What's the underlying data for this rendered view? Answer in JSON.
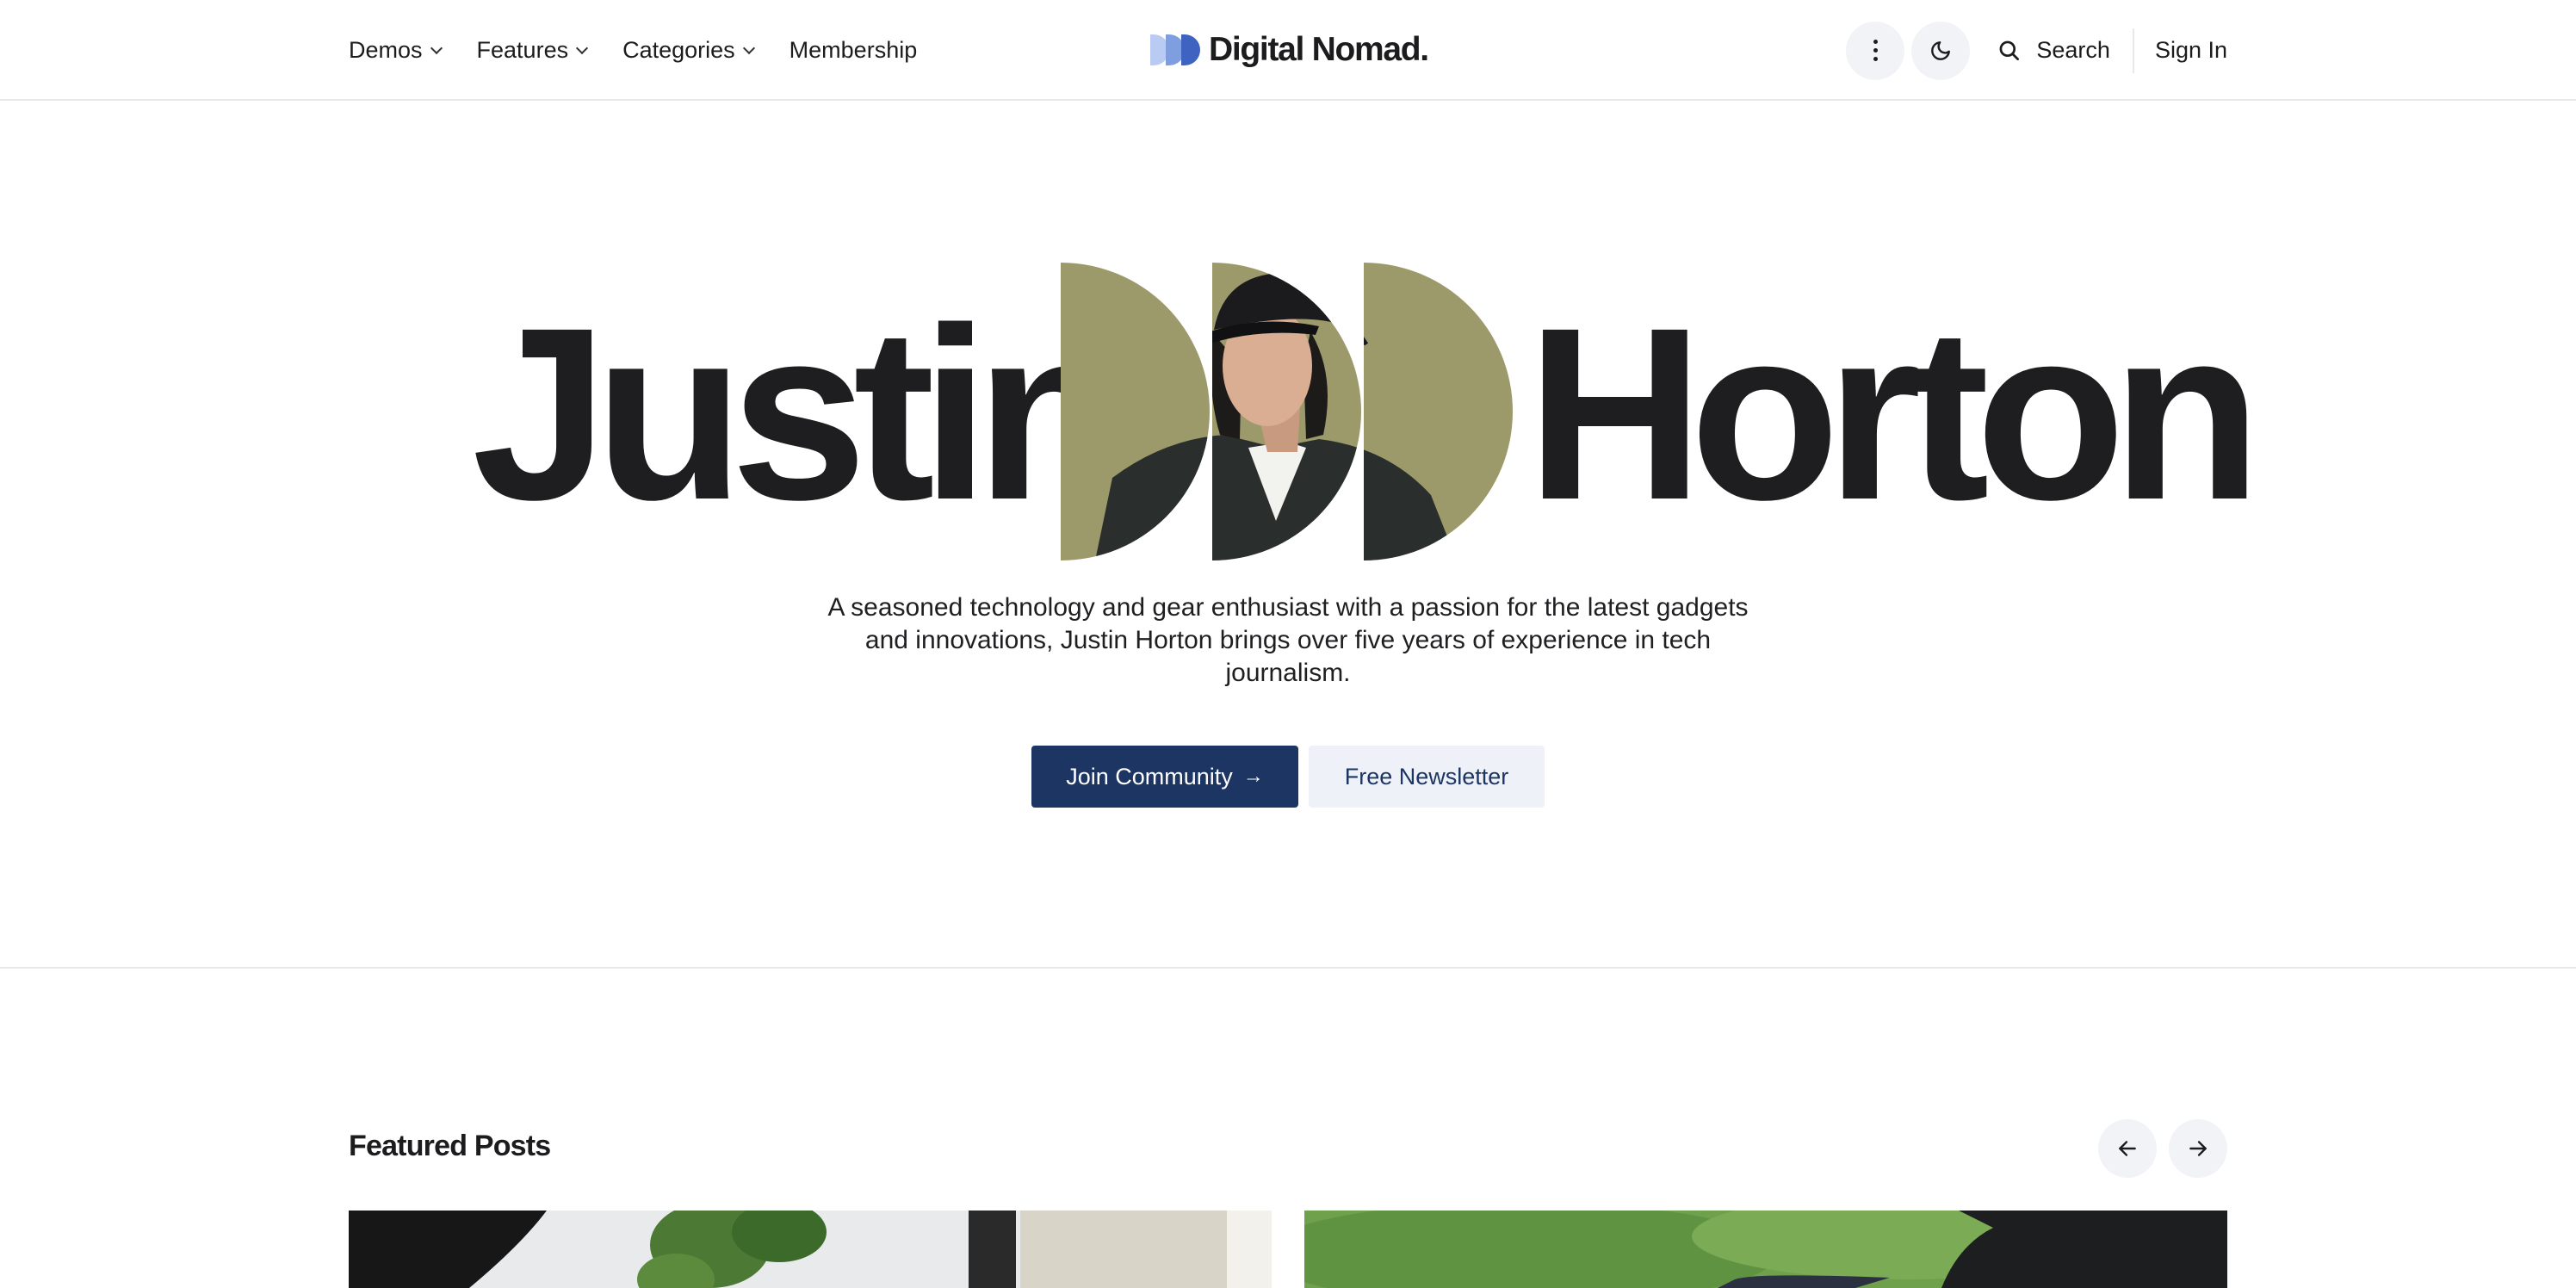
{
  "header": {
    "nav": [
      {
        "label": "Demos",
        "has_dropdown": true
      },
      {
        "label": "Features",
        "has_dropdown": true
      },
      {
        "label": "Categories",
        "has_dropdown": true
      },
      {
        "label": "Membership",
        "has_dropdown": false
      }
    ],
    "logo_text": "Digital Nomad.",
    "search_label": "Search",
    "signin_label": "Sign In"
  },
  "hero": {
    "first_name": "Justin",
    "last_name": "Horton",
    "tagline": "A seasoned technology and gear enthusiast with a passion for the latest gadgets and innovations, Justin Horton brings over five years of experience in tech journalism.",
    "join_label": "Join Community",
    "newsletter_label": "Free Newsletter"
  },
  "featured": {
    "title": "Featured Posts"
  },
  "icons": {
    "more": "more-vertical-icon",
    "theme": "moon-icon",
    "search": "search-icon",
    "prev": "arrow-left-icon",
    "next": "arrow-right-icon",
    "join_arrow": "arrow-right-icon"
  },
  "colors": {
    "primary": "#1c3563",
    "logo_light": "#b5c8f0",
    "logo_mid": "#7f9ee0",
    "logo_dark": "#3f63c0",
    "portrait_bg": "#9c9a6b",
    "text": "#1c1c1e"
  }
}
